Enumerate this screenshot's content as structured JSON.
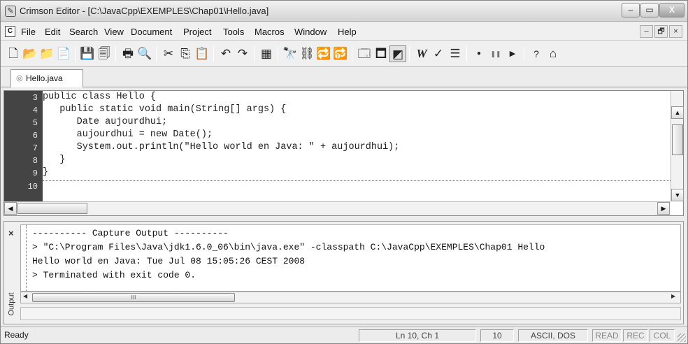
{
  "window": {
    "title": "Crimson Editor - [C:\\JavaCpp\\EXEMPLES\\Chap01\\Hello.java]",
    "app_icon": "crimson-editor-icon",
    "buttons": {
      "minimize": "–",
      "maximize": "▭",
      "close": "X"
    }
  },
  "menu": {
    "doc_icon": "C",
    "items": [
      "File",
      "Edit",
      "Search",
      "View",
      "Document",
      "Project",
      "Tools",
      "Macros",
      "Window",
      "Help"
    ],
    "mdi_buttons": {
      "minimize": "–",
      "restore": "🗗",
      "close": "×"
    }
  },
  "toolbar": {
    "buttons": [
      {
        "icon": "new-file-icon",
        "glyph": "🗋"
      },
      {
        "icon": "open-folder-icon",
        "glyph": "📂"
      },
      {
        "icon": "open-remote-icon",
        "glyph": "📁"
      },
      {
        "icon": "open-file-icon",
        "glyph": "📄"
      },
      {
        "icon": "save-icon",
        "glyph": "💾"
      },
      {
        "icon": "save-all-icon",
        "glyph": "🗐"
      },
      {
        "icon": "print-icon",
        "glyph": "🖶"
      },
      {
        "icon": "print-preview-icon",
        "glyph": "🔍"
      },
      {
        "icon": "cut-icon",
        "glyph": "✂"
      },
      {
        "icon": "copy-icon",
        "glyph": "⎘"
      },
      {
        "icon": "paste-icon",
        "glyph": "📋"
      },
      {
        "icon": "undo-icon",
        "glyph": "↶"
      },
      {
        "icon": "redo-icon",
        "glyph": "↷"
      },
      {
        "icon": "column-mode-icon",
        "glyph": "▦"
      },
      {
        "icon": "find-icon",
        "glyph": "🔭"
      },
      {
        "icon": "find-next-icon",
        "glyph": "⛓"
      },
      {
        "icon": "replace-icon",
        "glyph": "🔁"
      },
      {
        "icon": "find-in-files-icon",
        "glyph": "🔂"
      },
      {
        "icon": "view-toggle-icon",
        "glyph": "🗔"
      },
      {
        "icon": "output-window-icon",
        "glyph": "🗖"
      },
      {
        "icon": "directory-tree-icon",
        "glyph": "◩"
      },
      {
        "icon": "word-wrap-icon",
        "glyph": "W"
      },
      {
        "icon": "spell-check-icon",
        "glyph": "✓"
      },
      {
        "icon": "line-numbers-icon",
        "glyph": "☰"
      },
      {
        "icon": "record-macro-icon",
        "glyph": "●"
      },
      {
        "icon": "pause-macro-icon",
        "glyph": "❚❚"
      },
      {
        "icon": "play-macro-icon",
        "glyph": "▶"
      },
      {
        "icon": "help-icon",
        "glyph": "?"
      },
      {
        "icon": "home-icon",
        "glyph": "⌂"
      }
    ]
  },
  "tabs": [
    {
      "label": "Hello.java",
      "icon": "file-tab-icon",
      "glyph": "◎"
    }
  ],
  "editor": {
    "lines": [
      {
        "n": "3",
        "text": "public class Hello {"
      },
      {
        "n": "4",
        "text": "   public static void main(String[] args) {"
      },
      {
        "n": "5",
        "text": "      Date aujourdhui;"
      },
      {
        "n": "6",
        "text": "      aujourdhui = new Date();"
      },
      {
        "n": "7",
        "text": "      System.out.println(\"Hello world en Java: \" + aujourdhui);"
      },
      {
        "n": "8",
        "text": "   }"
      },
      {
        "n": "9",
        "text": "}"
      },
      {
        "n": "10",
        "text": ""
      }
    ],
    "scroll_up": "▲",
    "scroll_down": "▼",
    "scroll_left": "◀",
    "scroll_right": "▶"
  },
  "output": {
    "close": "×",
    "side_label": "Output",
    "lines": [
      "---------- Capture Output ----------",
      "> \"C:\\Program Files\\Java\\jdk1.6.0_06\\bin\\java.exe\" -classpath C:\\JavaCpp\\EXEMPLES\\Chap01 Hello",
      "Hello world en Java: Tue Jul 08 15:05:26 CEST 2008",
      "> Terminated with exit code 0."
    ],
    "thumb_grip": "III",
    "scroll_left": "◀",
    "scroll_right": "▶"
  },
  "status": {
    "ready": "Ready",
    "position": "Ln 10, Ch 1",
    "lines": "10",
    "encoding": "ASCII, DOS",
    "read": "READ",
    "rec": "REC",
    "col": "COL"
  }
}
